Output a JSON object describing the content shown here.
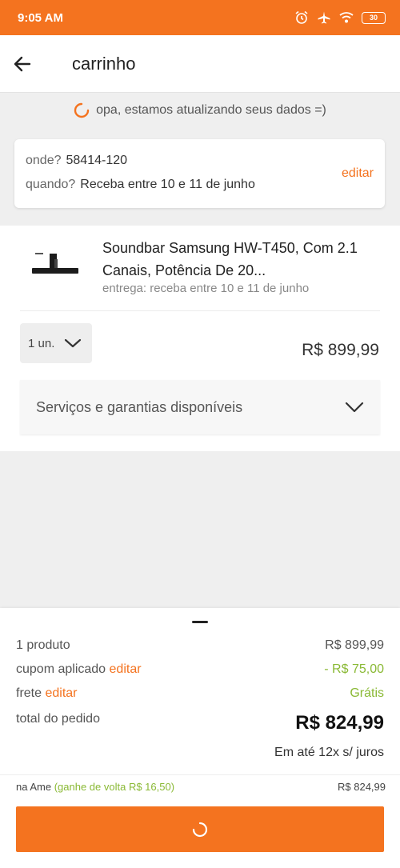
{
  "status_bar": {
    "time": "9:05 AM",
    "battery": "30"
  },
  "header": {
    "title": "carrinho"
  },
  "notice": {
    "text": "opa, estamos atualizando seus dados =)"
  },
  "delivery": {
    "where_label": "onde?",
    "zip": "58414-120",
    "when_label": "quando?",
    "when_value": "Receba entre 10 e 11 de junho",
    "edit_label": "editar"
  },
  "item": {
    "name": "Soundbar Samsung HW-T450, Com 2.1 Canais, Potência De 20...",
    "delivery": "entrega: receba entre 10 e 11 de junho",
    "quantity": "1 un.",
    "price": "R$ 899,99",
    "services_label": "Serviços e garantias disponíveis"
  },
  "summary": {
    "products_label": "1 produto",
    "products_value": "R$ 899,99",
    "coupon_label": "cupom aplicado",
    "coupon_edit": "editar",
    "coupon_value": "- R$ 75,00",
    "shipping_label": "frete",
    "shipping_edit": "editar",
    "shipping_value": "Grátis",
    "total_label": "total do pedido",
    "total_value": "R$ 824,99",
    "installments": "Em até 12x s/ juros",
    "ame_label": "na Ame",
    "ame_bonus": "(ganhe de volta R$ 16,50)",
    "ame_value": "R$ 824,99"
  },
  "colors": {
    "brand": "#f4731f",
    "green": "#8ab935"
  }
}
